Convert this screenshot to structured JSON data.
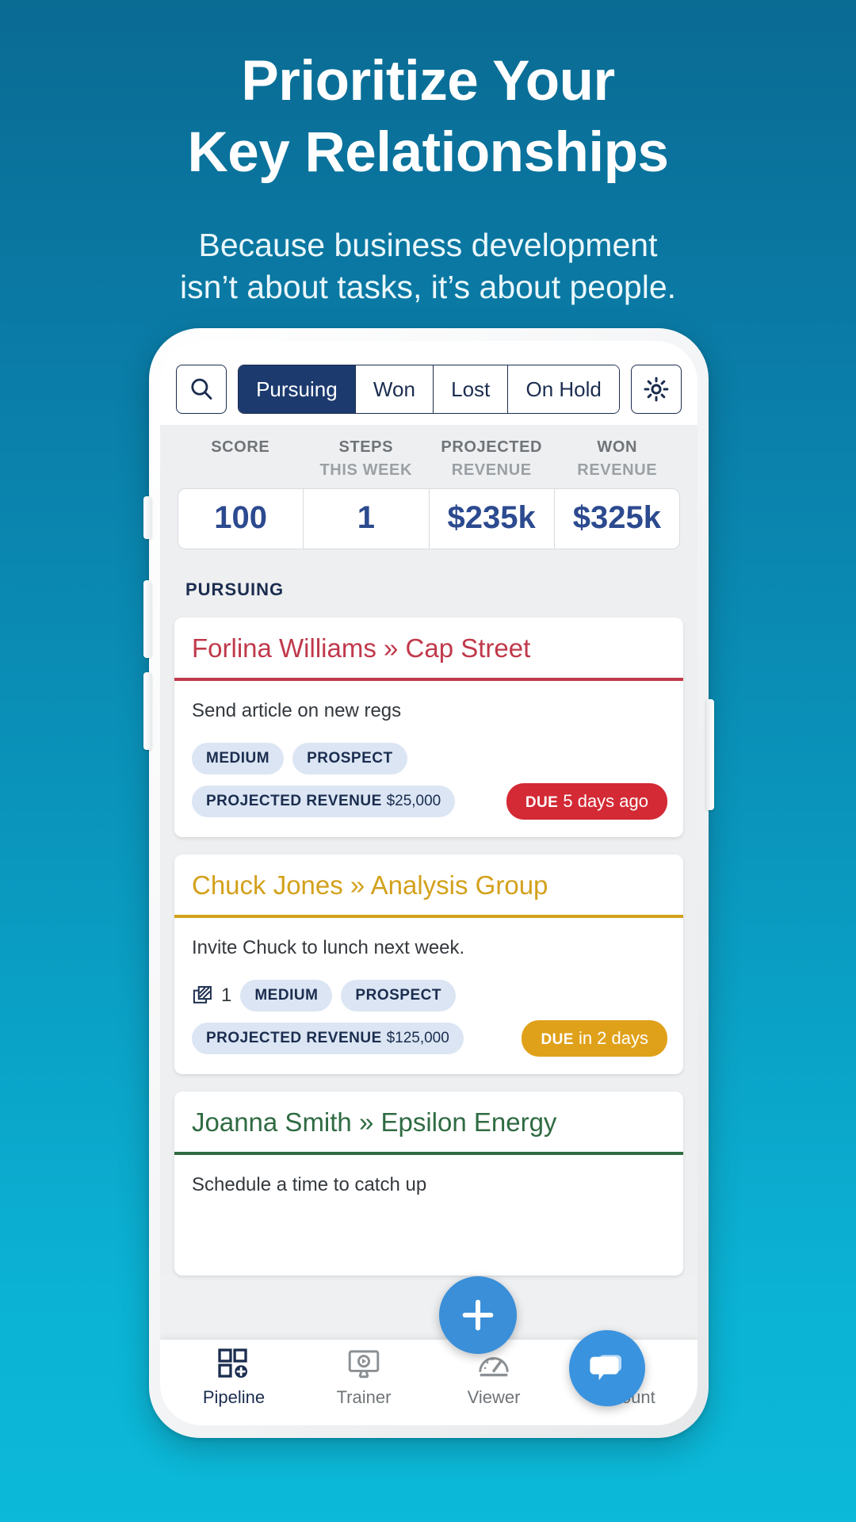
{
  "hero": {
    "title_line1": "Prioritize Your",
    "title_line2": "Key Relationships",
    "sub_line1": "Because business development",
    "sub_line2": "isn’t about tasks, it’s about people."
  },
  "colors": {
    "bg_top": "#0a6b93",
    "bg_bottom": "#0cb9d8",
    "navy": "#1b2d4f",
    "active_tab": "#1c3a6e",
    "stat_number": "#2c4a8f",
    "chip_bg": "#dbe5f3",
    "due_red": "#d32a35",
    "due_amber": "#e0a11a",
    "fab_blue": "#3a8fd8",
    "card1_accent": "#c0394b",
    "card2_accent": "#d3a11c",
    "card3_accent": "#2f6b42"
  },
  "toolbar": {
    "search_icon": "search-icon",
    "settings_icon": "gear-icon",
    "tabs": [
      {
        "label": "Pursuing",
        "active": true
      },
      {
        "label": "Won",
        "active": false
      },
      {
        "label": "Lost",
        "active": false
      },
      {
        "label": "On Hold",
        "active": false
      }
    ]
  },
  "stats": {
    "columns": [
      {
        "title": "SCORE",
        "subtitle": "",
        "value": "100"
      },
      {
        "title": "STEPS",
        "subtitle": "THIS WEEK",
        "value": "1"
      },
      {
        "title": "PROJECTED",
        "subtitle": "REVENUE",
        "value": "$235k"
      },
      {
        "title": "WON",
        "subtitle": "REVENUE",
        "value": "$325k"
      }
    ]
  },
  "section": {
    "label": "PURSUING"
  },
  "cards": [
    {
      "title": "Forlina Williams » Cap Street",
      "task": "Send article on new regs",
      "chips": [
        "MEDIUM",
        "PROSPECT"
      ],
      "revenue_label": "PROJECTED REVENUE",
      "revenue_value": "$25,000",
      "due_prefix": "DUE",
      "due_text": "5 days ago",
      "attachment_count": null
    },
    {
      "title": "Chuck Jones » Analysis Group",
      "task": "Invite Chuck to lunch next week.",
      "chips": [
        "MEDIUM",
        "PROSPECT"
      ],
      "revenue_label": "PROJECTED REVENUE",
      "revenue_value": "$125,000",
      "due_prefix": "DUE",
      "due_text": "in 2 days",
      "attachment_count": "1"
    },
    {
      "title": "Joanna Smith » Epsilon Energy",
      "task": "Schedule a time to catch up",
      "chips": [],
      "revenue_label": "",
      "revenue_value": "",
      "due_prefix": "",
      "due_text": "",
      "attachment_count": null
    }
  ],
  "bottom_nav": [
    {
      "label": "Pipeline",
      "icon": "pipeline-icon",
      "active": true
    },
    {
      "label": "Trainer",
      "icon": "trainer-icon",
      "active": false
    },
    {
      "label": "Viewer",
      "icon": "viewer-icon",
      "active": false
    },
    {
      "label": "Account",
      "icon": "account-icon",
      "active": false
    }
  ],
  "fabs": {
    "add_icon": "plus-icon",
    "chat_icon": "chat-bubble-icon"
  }
}
